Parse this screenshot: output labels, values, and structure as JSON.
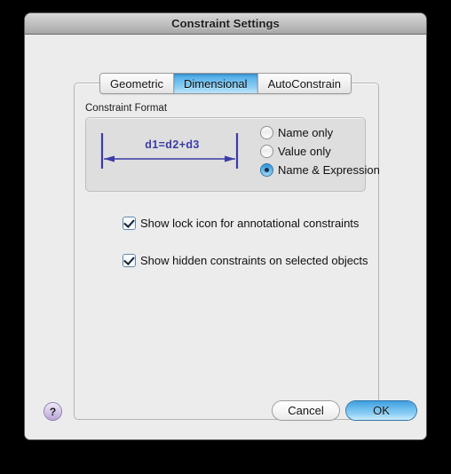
{
  "window": {
    "title": "Constraint Settings"
  },
  "tabs": [
    {
      "label": "Geometric",
      "active": false
    },
    {
      "label": "Dimensional",
      "active": true
    },
    {
      "label": "AutoConstrain",
      "active": false
    }
  ],
  "constraint_format": {
    "group_label": "Constraint Format",
    "preview_text": "d1=d2+d3",
    "preview_color": "#3c3ca8",
    "options": [
      {
        "label": "Name only",
        "selected": false
      },
      {
        "label": "Value only",
        "selected": false
      },
      {
        "label": "Name & Expression",
        "selected": true
      }
    ]
  },
  "checkboxes": [
    {
      "label": "Show lock icon for annotational constraints",
      "checked": true
    },
    {
      "label": "Show hidden constraints on selected objects",
      "checked": true
    }
  ],
  "footer": {
    "help_label": "?",
    "cancel_label": "Cancel",
    "ok_label": "OK"
  },
  "colors": {
    "accent_blue": "#61b6ea",
    "dimension_blue": "#3c3ca8",
    "window_bg": "#ececec",
    "group_bg": "#dedede",
    "help_purple": "#b9a6d6"
  }
}
